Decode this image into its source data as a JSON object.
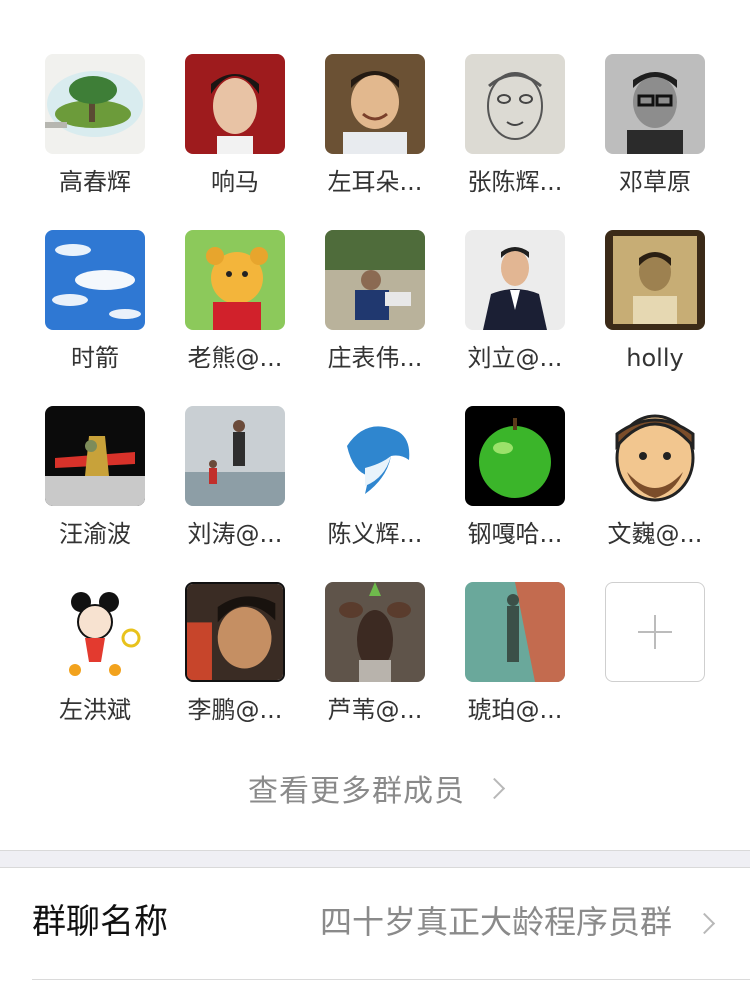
{
  "members": [
    {
      "name": "高春辉",
      "avatar_icon": "lightbulb-tree-icon"
    },
    {
      "name": "响马",
      "avatar_icon": "man-portrait-red-icon"
    },
    {
      "name": "左耳朵...",
      "avatar_icon": "man-portrait-laughing-icon"
    },
    {
      "name": "张陈辉...",
      "avatar_icon": "sketched-face-icon"
    },
    {
      "name": "邓草原",
      "avatar_icon": "glasses-man-bw-icon"
    },
    {
      "name": "时箭",
      "avatar_icon": "blue-sky-clouds-icon"
    },
    {
      "name": "老熊@...",
      "avatar_icon": "bear-cartoon-icon"
    },
    {
      "name": "庄表伟...",
      "avatar_icon": "man-reading-outdoors-icon"
    },
    {
      "name": "刘立@...",
      "avatar_icon": "man-in-suit-icon"
    },
    {
      "name": "holly",
      "avatar_icon": "vintage-boy-photo-icon"
    },
    {
      "name": "汪渝波",
      "avatar_icon": "toy-airplane-icon"
    },
    {
      "name": "刘涛@...",
      "avatar_icon": "beach-walk-icon"
    },
    {
      "name": "陈义辉...",
      "avatar_icon": "dolphin-icon"
    },
    {
      "name": "钢嘎哈...",
      "avatar_icon": "green-apple-icon"
    },
    {
      "name": "文巍@...",
      "avatar_icon": "bearded-face-cartoon-icon"
    },
    {
      "name": "左洪斌",
      "avatar_icon": "cartoon-girl-icon"
    },
    {
      "name": "李鹏@...",
      "avatar_icon": "man-selfie-icon"
    },
    {
      "name": "芦苇@...",
      "avatar_icon": "okapi-party-hat-icon"
    },
    {
      "name": "琥珀@...",
      "avatar_icon": "shadow-on-track-icon"
    }
  ],
  "add_member_icon": "plus-icon",
  "more_members_label": "查看更多群成员",
  "group_name": {
    "label": "群聊名称",
    "value": "四十岁真正大龄程序员群"
  }
}
